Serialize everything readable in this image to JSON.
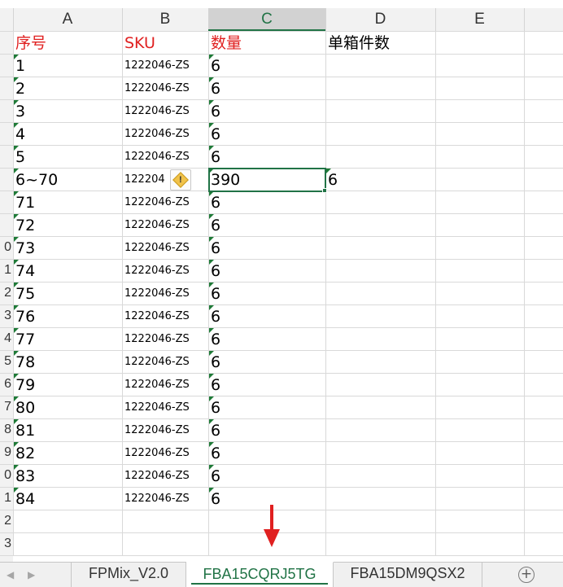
{
  "columns": [
    "A",
    "B",
    "C",
    "D",
    "E"
  ],
  "selected_column": "C",
  "row_numbers": [
    "",
    "",
    "",
    "",
    "",
    "",
    "",
    "",
    "",
    "0",
    "1",
    "2",
    "3",
    "4",
    "5",
    "6",
    "7",
    "8",
    "9",
    "0",
    "1",
    "2",
    "3"
  ],
  "header_row": {
    "a": "序号",
    "b": "SKU",
    "c": "数量",
    "d": "单箱件数"
  },
  "rows": [
    {
      "a": "1",
      "b": "1222046-ZS",
      "c": "6"
    },
    {
      "a": "2",
      "b": "1222046-ZS",
      "c": "6"
    },
    {
      "a": "3",
      "b": "1222046-ZS",
      "c": "6"
    },
    {
      "a": "4",
      "b": "1222046-ZS",
      "c": "6"
    },
    {
      "a": "5",
      "b": "1222046-ZS",
      "c": "6"
    },
    {
      "a": "6~70",
      "b": "122204",
      "c": "390",
      "d": "6"
    },
    {
      "a": "71",
      "b": "1222046-ZS",
      "c": "6"
    },
    {
      "a": "72",
      "b": "1222046-ZS",
      "c": "6"
    },
    {
      "a": "73",
      "b": "1222046-ZS",
      "c": "6"
    },
    {
      "a": "74",
      "b": "1222046-ZS",
      "c": "6"
    },
    {
      "a": "75",
      "b": "1222046-ZS",
      "c": "6"
    },
    {
      "a": "76",
      "b": "1222046-ZS",
      "c": "6"
    },
    {
      "a": "77",
      "b": "1222046-ZS",
      "c": "6"
    },
    {
      "a": "78",
      "b": "1222046-ZS",
      "c": "6"
    },
    {
      "a": "79",
      "b": "1222046-ZS",
      "c": "6"
    },
    {
      "a": "80",
      "b": "1222046-ZS",
      "c": "6"
    },
    {
      "a": "81",
      "b": "1222046-ZS",
      "c": "6"
    },
    {
      "a": "82",
      "b": "1222046-ZS",
      "c": "6"
    },
    {
      "a": "83",
      "b": "1222046-ZS",
      "c": "6"
    },
    {
      "a": "84",
      "b": "1222046-ZS",
      "c": "6"
    }
  ],
  "warning_icon": "warning-diamond-icon",
  "tabs": [
    {
      "label": "FPMix_V2.0",
      "active": false
    },
    {
      "label": "FBA15CQRJ5TG",
      "active": true
    },
    {
      "label": "FBA15DM9QSX2",
      "active": false
    }
  ],
  "add_sheet_label": "+",
  "nav_prev_label": "◀",
  "nav_next_label": "▶",
  "colors": {
    "accent": "#217346",
    "red_text": "#e02020",
    "error_triangle": "#1e7a37",
    "annotation_arrow": "#e02020"
  }
}
